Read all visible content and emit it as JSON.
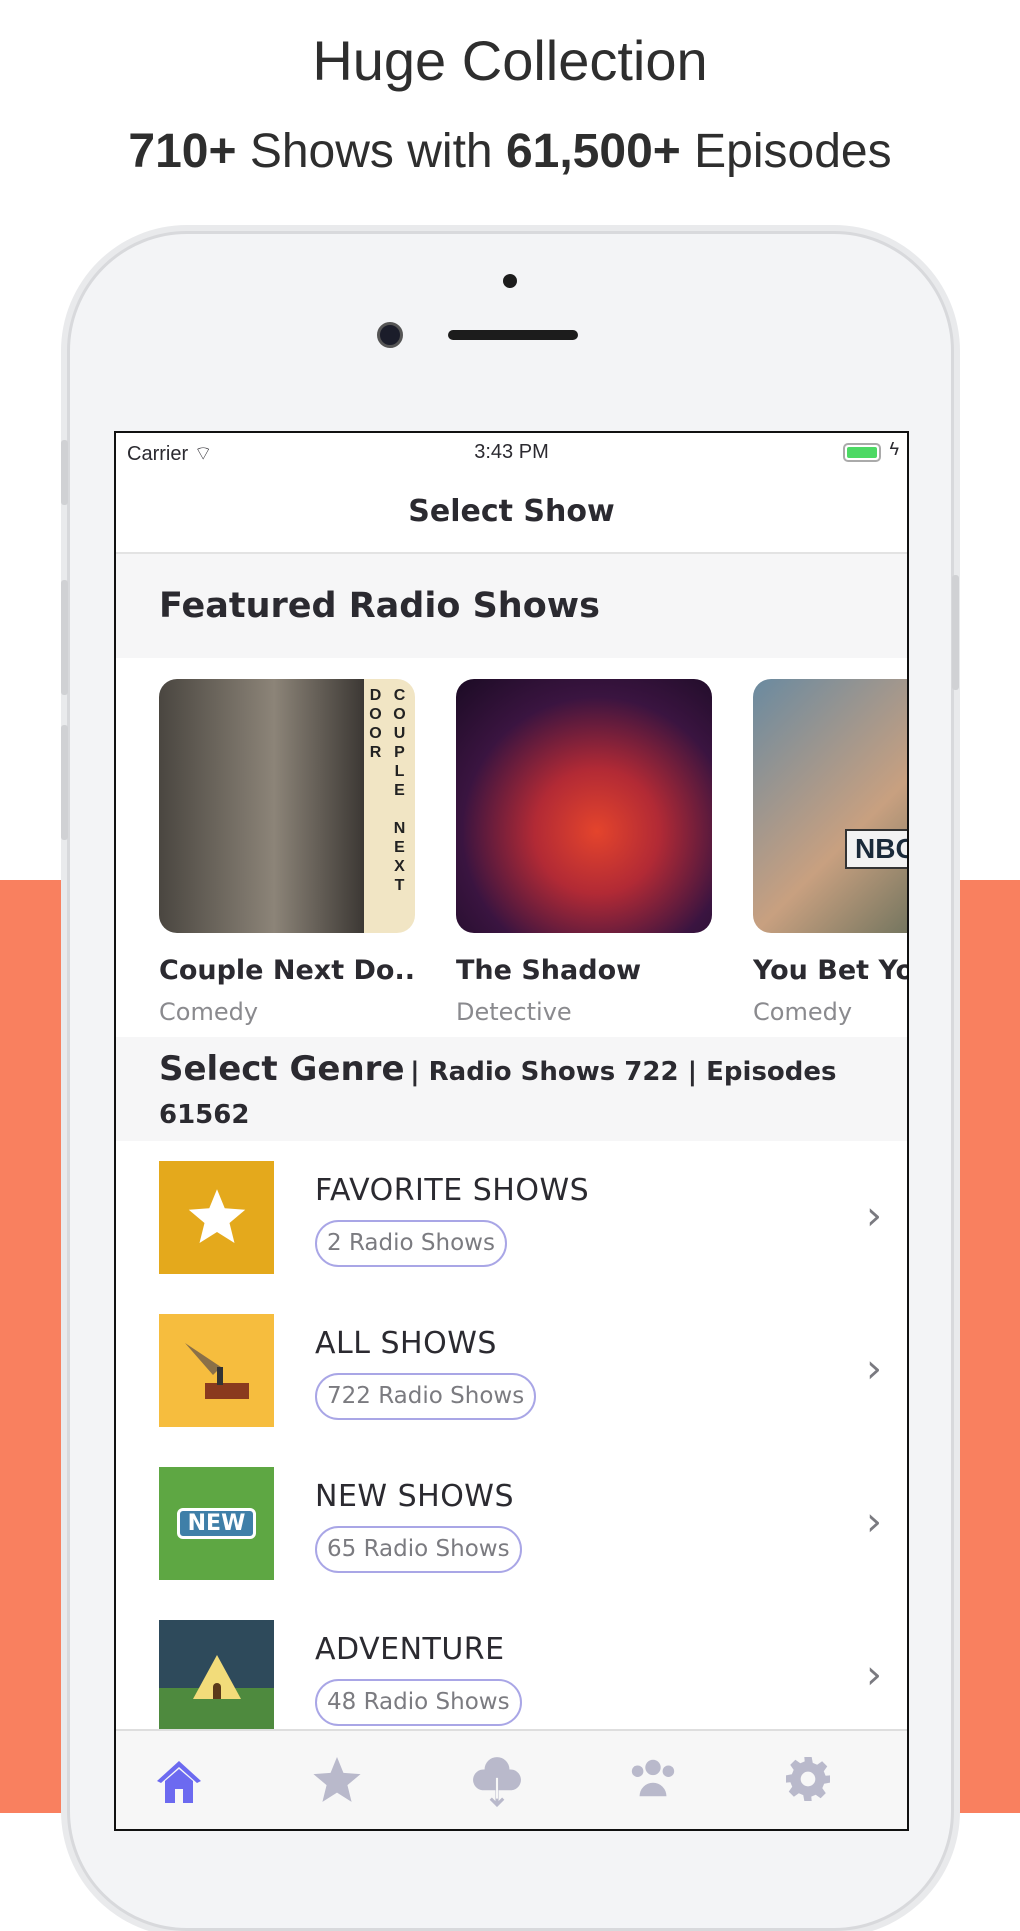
{
  "promo": {
    "title": "Huge Collection",
    "shows_count": "710+",
    "shows_text": "Shows with",
    "episodes_count": "61,500+",
    "episodes_text": "Episodes"
  },
  "status": {
    "carrier": "Carrier",
    "time": "3:43 PM"
  },
  "nav": {
    "title": "Select Show"
  },
  "featured": {
    "header": "Featured Radio Shows",
    "items": [
      {
        "title": "Couple Next Do...",
        "genre": "Comedy",
        "art_text": "COUPLE NEXT DOOR"
      },
      {
        "title": "The Shadow",
        "genre": "Detective"
      },
      {
        "title": "You Bet Yo",
        "genre": "Comedy",
        "art_text": "NBC"
      }
    ]
  },
  "genre_header": {
    "title": "Select Genre",
    "stats": "| Radio Shows 722 | Episodes 61562"
  },
  "genres": [
    {
      "title": "FAVORITE SHOWS",
      "count": "2 Radio Shows",
      "icon": "star-icon",
      "color": "#e4a91c"
    },
    {
      "title": "ALL SHOWS",
      "count": "722 Radio Shows",
      "icon": "gramophone-icon",
      "color": "#f6bd3e"
    },
    {
      "title": "NEW SHOWS",
      "count": "65 Radio Shows",
      "icon": "new-sign-icon",
      "color": "#5ea743",
      "badge": "NEW"
    },
    {
      "title": "ADVENTURE",
      "count": "48 Radio Shows",
      "icon": "tent-icon",
      "color": "#2e4a5b"
    }
  ],
  "tabs": [
    {
      "icon": "home-icon",
      "active": true
    },
    {
      "icon": "star-icon"
    },
    {
      "icon": "cloud-download-icon"
    },
    {
      "icon": "users-icon"
    },
    {
      "icon": "gear-icon"
    }
  ],
  "colors": {
    "accent": "#6c6af0",
    "inactive_tab": "#b9b9cb",
    "background": "#f9805f"
  }
}
